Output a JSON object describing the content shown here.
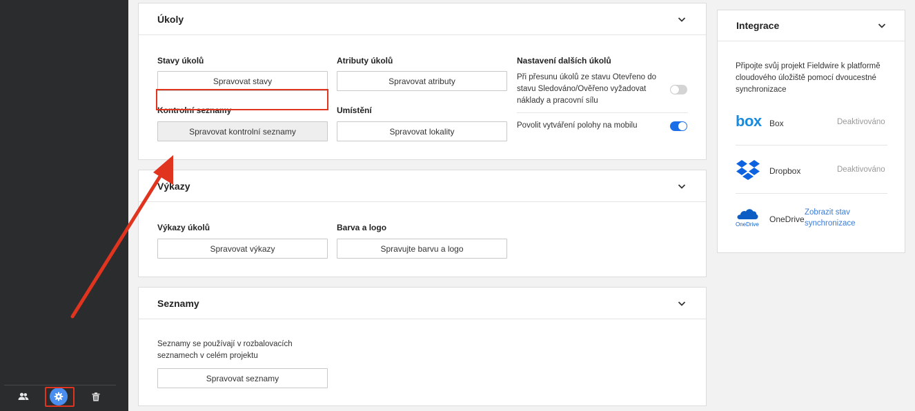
{
  "sidebar": {
    "icons": [
      "users-icon",
      "gear-icon",
      "trash-icon"
    ]
  },
  "tasks": {
    "title": "Úkoly",
    "task_states": {
      "label": "Stavy úkolů",
      "button": "Spravovat stavy"
    },
    "task_attributes": {
      "label": "Atributy úkolů",
      "button": "Spravovat atributy"
    },
    "checklists": {
      "label": "Kontrolní seznamy",
      "button": "Spravovat kontrolní seznamy"
    },
    "locations": {
      "label": "Umístění",
      "button": "Spravovat lokality"
    },
    "more_settings": {
      "label": "Nastavení dalších úkolů",
      "setting1": {
        "line1": "Při přesunu úkolů ze stavu Otevřeno do",
        "line2": "stavu Sledováno/Ověřeno vyžadovat",
        "line3": "náklady a pracovní sílu",
        "enabled": false
      },
      "setting2": {
        "text": "Povolit vytváření polohy na mobilu",
        "enabled": true
      }
    }
  },
  "reports": {
    "title": "Výkazy",
    "task_reports": {
      "label": "Výkazy úkolů",
      "button": "Spravovat výkazy"
    },
    "color_logo": {
      "label": "Barva a logo",
      "button": "Spravujte barvu a logo"
    }
  },
  "lists": {
    "title": "Seznamy",
    "desc_line1": "Seznamy se používají v rozbalovacích",
    "desc_line2": "seznamech v celém projektu",
    "button": "Spravovat seznamy"
  },
  "integrations": {
    "title": "Integrace",
    "desc_line1": "Připojte svůj projekt Fieldwire k platformě",
    "desc_line2": "cloudového úložiště pomocí dvoucestné",
    "desc_line3": "synchronizace",
    "box": {
      "name": "Box",
      "status": "Deaktivováno",
      "logo_text": "box"
    },
    "dropbox": {
      "name": "Dropbox",
      "status": "Deaktivováno"
    },
    "onedrive": {
      "name": "OneDrive",
      "logo_text": "OneDrive",
      "link_line1": "Zobrazit stav",
      "link_line2": "synchronizace"
    }
  },
  "colors": {
    "accent_blue": "#1c6ee8",
    "highlight_red": "#e0341f",
    "sidebar_bg": "#2b2c2e"
  }
}
